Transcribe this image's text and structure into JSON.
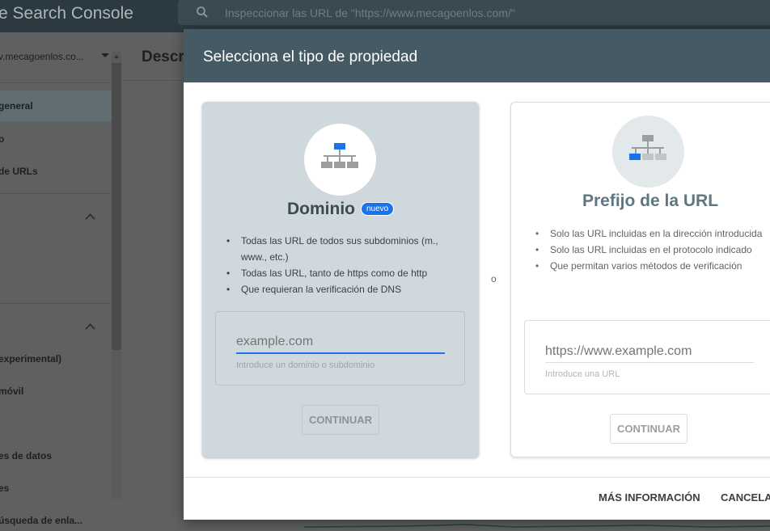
{
  "app": {
    "title": "e Search Console",
    "search_placeholder": "Inspeccionar las URL de \"https://www.mecagoenlos.com/\""
  },
  "sidebar": {
    "property": "v.mecagoenlos.co...",
    "items": [
      {
        "label": "general"
      },
      {
        "label": "o"
      },
      {
        "label": "de URLs"
      },
      {
        "label": "experimental)"
      },
      {
        "label": "móvil"
      },
      {
        "label": "es de datos"
      },
      {
        "label": "es"
      },
      {
        "label": "úsqueda de enla..."
      }
    ]
  },
  "main": {
    "title": "Descr"
  },
  "dialog": {
    "title": "Selecciona el tipo de propiedad",
    "or": "o",
    "domain": {
      "heading": "Dominio",
      "badge": "nuevo",
      "bullets": [
        "Todas las URL de todos sus subdominios (m., www., etc.)",
        "Todas las URL, tanto de https como de http",
        "Que requieran la verificación de DNS"
      ],
      "input_placeholder": "example.com",
      "input_hint": "Introduce un dominio o subdominio",
      "continue": "CONTINUAR"
    },
    "prefix": {
      "heading": "Prefijo de la URL",
      "bullets": [
        "Solo las URL incluidas en la dirección introducida",
        "Solo las URL incluidas en el protocolo indicado",
        "Que permitan varios métodos de verificación"
      ],
      "input_placeholder": "https://www.example.com",
      "input_hint": "Introduce una URL",
      "continue": "CONTINUAR"
    },
    "footer": {
      "more_info": "MÁS INFORMACIÓN",
      "cancel": "CANCELA"
    }
  },
  "colors": {
    "dialog_header": "#455a64",
    "domain_card": "#cfd8dc",
    "accent": "#1a73e8"
  }
}
